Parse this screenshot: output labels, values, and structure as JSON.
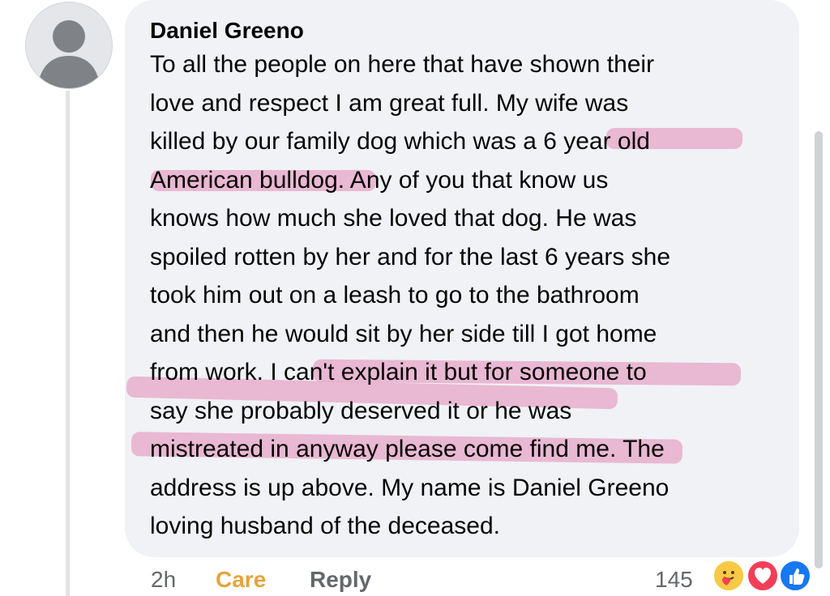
{
  "comment": {
    "author": "Daniel Greeno",
    "lines": [
      "To all the people on here that have shown their",
      "love and respect I am great full. My wife was",
      "killed by our family dog which was a 6 year old",
      "American bulldog. Any of you that know us",
      "knows how much she loved that dog. He was",
      "spoiled rotten by her and for the last 6 years she",
      "took him out on a leash to go to the bathroom",
      "and then he would sit by her side till I got home",
      "from work. I can't explain it but for someone to",
      "say she probably deserved it or he was",
      "mistreated in anyway please come find me. The",
      "address is up above. My name is Daniel Greeno",
      "loving husband of the deceased."
    ]
  },
  "footer": {
    "time": "2h",
    "reaction_label": "Care",
    "reply_label": "Reply",
    "reaction_count": "145"
  },
  "reactions": [
    "care-icon",
    "love-icon",
    "like-icon"
  ],
  "colors": {
    "highlight": "#e7a4c7",
    "care": "#e6a43c",
    "love": "#f33e58",
    "like": "#1877f2",
    "bubble": "#f0f2f5"
  }
}
